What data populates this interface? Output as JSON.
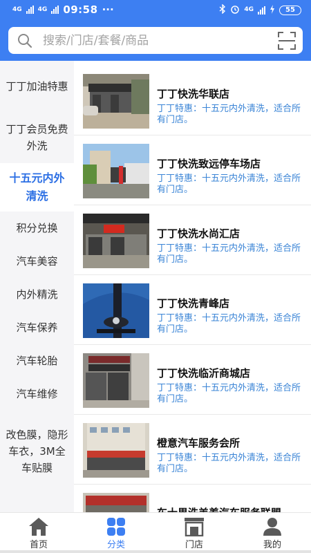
{
  "status_bar": {
    "network_1": "4G",
    "network_2": "4G",
    "time": "09:58",
    "more": "···",
    "right_network": "4G",
    "battery": "55"
  },
  "search": {
    "placeholder": "搜索/门店/套餐/商品"
  },
  "sidebar": {
    "items": [
      {
        "label": "丁丁加油特惠",
        "active": false
      },
      {
        "label": "丁丁会员免费外洗",
        "active": false
      },
      {
        "label": "十五元内外清洗",
        "active": true
      },
      {
        "label": "积分兑换",
        "active": false
      },
      {
        "label": "汽车美容",
        "active": false
      },
      {
        "label": "内外精洗",
        "active": false
      },
      {
        "label": "汽车保养",
        "active": false
      },
      {
        "label": "汽车轮胎",
        "active": false
      },
      {
        "label": "汽车维修",
        "active": false
      },
      {
        "label": "改色膜，隐形车衣，3M全车贴膜",
        "active": false
      }
    ]
  },
  "stores": [
    {
      "name": "丁丁快洗华联店",
      "promo": "丁丁特惠：十五元内外清洗，适合所有门店。",
      "image": "store-front-photo"
    },
    {
      "name": "丁丁快洗致远停车场店",
      "promo": "丁丁特惠：十五元内外清洗，适合所有门店。",
      "image": "car-wash-station-photo"
    },
    {
      "name": "丁丁快洗水尚汇店",
      "promo": "丁丁特惠：十五元内外清洗，适合所有门店。",
      "image": "car-wash-shop-photo"
    },
    {
      "name": "丁丁快洗青峰店",
      "promo": "丁丁特惠：十五元内外清洗，适合所有门店。",
      "image": "blue-car-photo"
    },
    {
      "name": "丁丁快洗临沂商城店",
      "promo": "丁丁特惠：十五元内外清洗，适合所有门店。",
      "image": "shop-street-photo"
    },
    {
      "name": "橙意汽车服务会所",
      "promo": "丁丁特惠：十五元内外清洗，适合所有门店。",
      "image": "building-photo"
    },
    {
      "name": "车士界洗美养汽车服务联盟",
      "promo": "",
      "image": "shop-sign-photo"
    }
  ],
  "tabbar": {
    "items": [
      {
        "label": "首页",
        "icon": "home-icon",
        "active": false
      },
      {
        "label": "分类",
        "icon": "category-icon",
        "active": true
      },
      {
        "label": "门店",
        "icon": "store-icon",
        "active": false
      },
      {
        "label": "我的",
        "icon": "profile-icon",
        "active": false
      }
    ]
  },
  "colors": {
    "brand_blue": "#3d7ff2",
    "promo_text": "#3a84d6",
    "sidebar_bg": "#f5f5f7",
    "active_text": "#2c6fe4"
  }
}
